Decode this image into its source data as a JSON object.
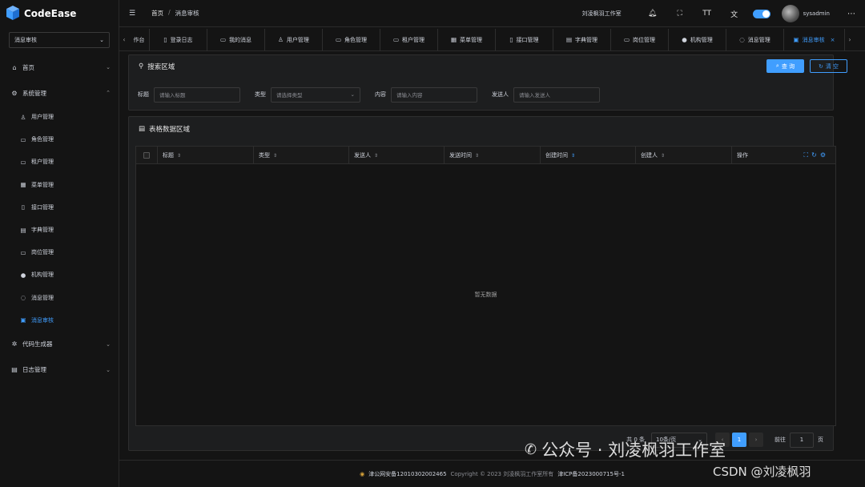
{
  "app": {
    "name": "CodeEase",
    "brand_color": "#409eff"
  },
  "sidebar": {
    "select_value": "消息审核",
    "menu": [
      {
        "label": "首页",
        "icon": "home-icon"
      },
      {
        "label": "系统管理",
        "icon": "gear-icon"
      }
    ],
    "sub_items": [
      {
        "label": "用户管理",
        "icon": "user-icon"
      },
      {
        "label": "角色管理",
        "icon": "id-card-icon"
      },
      {
        "label": "租户管理",
        "icon": "tenant-icon"
      },
      {
        "label": "菜单管理",
        "icon": "grid-icon"
      },
      {
        "label": "接口管理",
        "icon": "api-icon"
      },
      {
        "label": "字典管理",
        "icon": "book-icon"
      },
      {
        "label": "岗位管理",
        "icon": "post-icon"
      },
      {
        "label": "机构管理",
        "icon": "org-icon"
      },
      {
        "label": "消息管理",
        "icon": "chat-icon"
      },
      {
        "label": "消息审核",
        "icon": "clipboard-icon"
      }
    ],
    "menu_bottom": [
      {
        "label": "代码生成器",
        "icon": "cog-icon"
      },
      {
        "label": "日志管理",
        "icon": "log-icon"
      }
    ]
  },
  "header": {
    "breadcrumb_home": "首页",
    "breadcrumb_sep": "/",
    "breadcrumb_current": "消息审核",
    "studio": "刘凌枫羽工作室",
    "username": "sysadmin"
  },
  "tabs": [
    {
      "label": "作台",
      "icon": ""
    },
    {
      "label": "登录日志",
      "icon": "doc-icon"
    },
    {
      "label": "我的消息",
      "icon": "message-icon"
    },
    {
      "label": "用户管理",
      "icon": "user-icon"
    },
    {
      "label": "角色管理",
      "icon": "id-card-icon"
    },
    {
      "label": "租户管理",
      "icon": "tenant-icon"
    },
    {
      "label": "菜单管理",
      "icon": "grid-icon"
    },
    {
      "label": "接口管理",
      "icon": "api-icon"
    },
    {
      "label": "字典管理",
      "icon": "book-icon"
    },
    {
      "label": "岗位管理",
      "icon": "post-icon"
    },
    {
      "label": "机构管理",
      "icon": "org-icon"
    },
    {
      "label": "消息管理",
      "icon": "chat-icon"
    },
    {
      "label": "消息审核",
      "icon": "clipboard-icon",
      "active": true
    }
  ],
  "search": {
    "title": "搜索区域",
    "query_label": "查 询",
    "reset_label": "清 空",
    "fields": [
      {
        "label": "标题",
        "placeholder": "请输入标题"
      },
      {
        "label": "类型",
        "placeholder": "请选择类型"
      },
      {
        "label": "内容",
        "placeholder": "请输入内容"
      },
      {
        "label": "发送人",
        "placeholder": "请输入发送人"
      }
    ]
  },
  "table": {
    "title": "表格数据区域",
    "columns": [
      "标题",
      "类型",
      "发送人",
      "发送时间",
      "创建时间",
      "创建人",
      "操作"
    ],
    "empty_text": "暂无数据"
  },
  "pagination": {
    "total_text": "共 0 条",
    "page_size": "10条/页",
    "current_page": "1",
    "goto_label": "前往",
    "goto_value": "1",
    "page_unit": "页"
  },
  "footer": {
    "police": "津公网安备12010302002465",
    "copyright": "Copyright © 2023 刘凌枫羽工作室所有",
    "icp": "津ICP备2023000715号-1"
  },
  "watermark": {
    "text": "公众号 · 刘凌枫羽工作室",
    "csdn": "CSDN @刘凌枫羽"
  }
}
